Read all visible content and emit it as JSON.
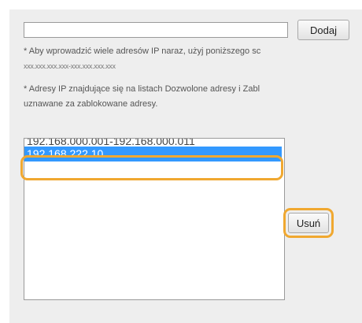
{
  "form": {
    "ip_input_value": "",
    "add_button_label": "Dodaj",
    "delete_button_label": "Usuń"
  },
  "notes": {
    "multi_ip_hint": "* Aby wprowadzić wiele adresów IP naraz, użyj poniższego sc",
    "format_example": "xxx.xxx.xxx.xxx-xxx.xxx.xxx.xxx",
    "conflict_line1": "* Adresy IP znajdujące się na listach Dozwolone adresy i Zabl",
    "conflict_line2": "uznawane za zablokowane adresy."
  },
  "ip_list": {
    "items": [
      {
        "text": "192.168.000.001-192.168.000.011",
        "selected": false
      },
      {
        "text": "192.168.222.10",
        "selected": true
      }
    ]
  },
  "colors": {
    "selection": "#3399ff",
    "callout": "#f0a830"
  }
}
